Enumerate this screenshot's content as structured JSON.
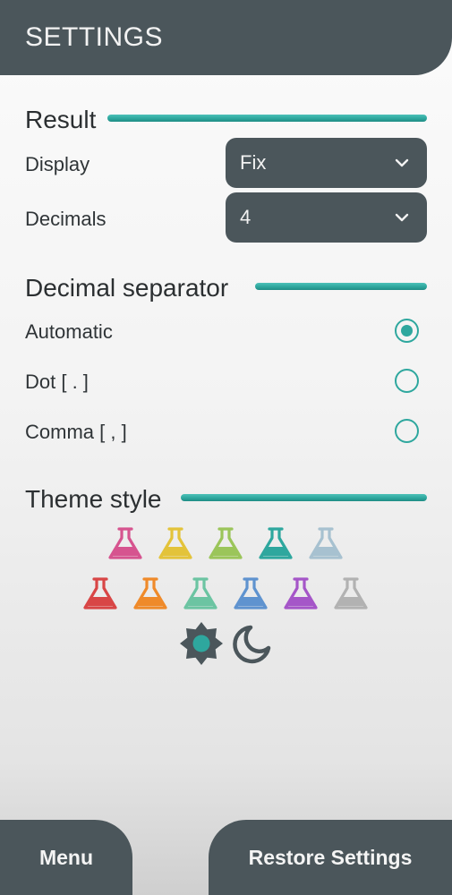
{
  "header": {
    "title": "SETTINGS"
  },
  "result": {
    "title": "Result",
    "display": {
      "label": "Display",
      "value": "Fix"
    },
    "decimals": {
      "label": "Decimals",
      "value": "4"
    }
  },
  "decimal_separator": {
    "title": "Decimal separator",
    "options": [
      {
        "label": "Automatic",
        "selected": true
      },
      {
        "label": "Dot [ . ]",
        "selected": false
      },
      {
        "label": "Comma [ , ]",
        "selected": false
      }
    ]
  },
  "theme": {
    "title": "Theme style",
    "colors_row1": [
      "#d6548f",
      "#e3c33a",
      "#9bc55a",
      "#2ea79e",
      "#a7c1d0"
    ],
    "colors_row2": [
      "#d84646",
      "#ef8a2a",
      "#6cc4a2",
      "#5f93cf",
      "#a556c8",
      "#b2b2b2"
    ],
    "modes": [
      "sun-icon",
      "moon-icon"
    ]
  },
  "accent_color": "#2ea79e",
  "dark_color": "#4b565b",
  "footer": {
    "menu_label": "Menu",
    "restore_label": "Restore Settings"
  }
}
